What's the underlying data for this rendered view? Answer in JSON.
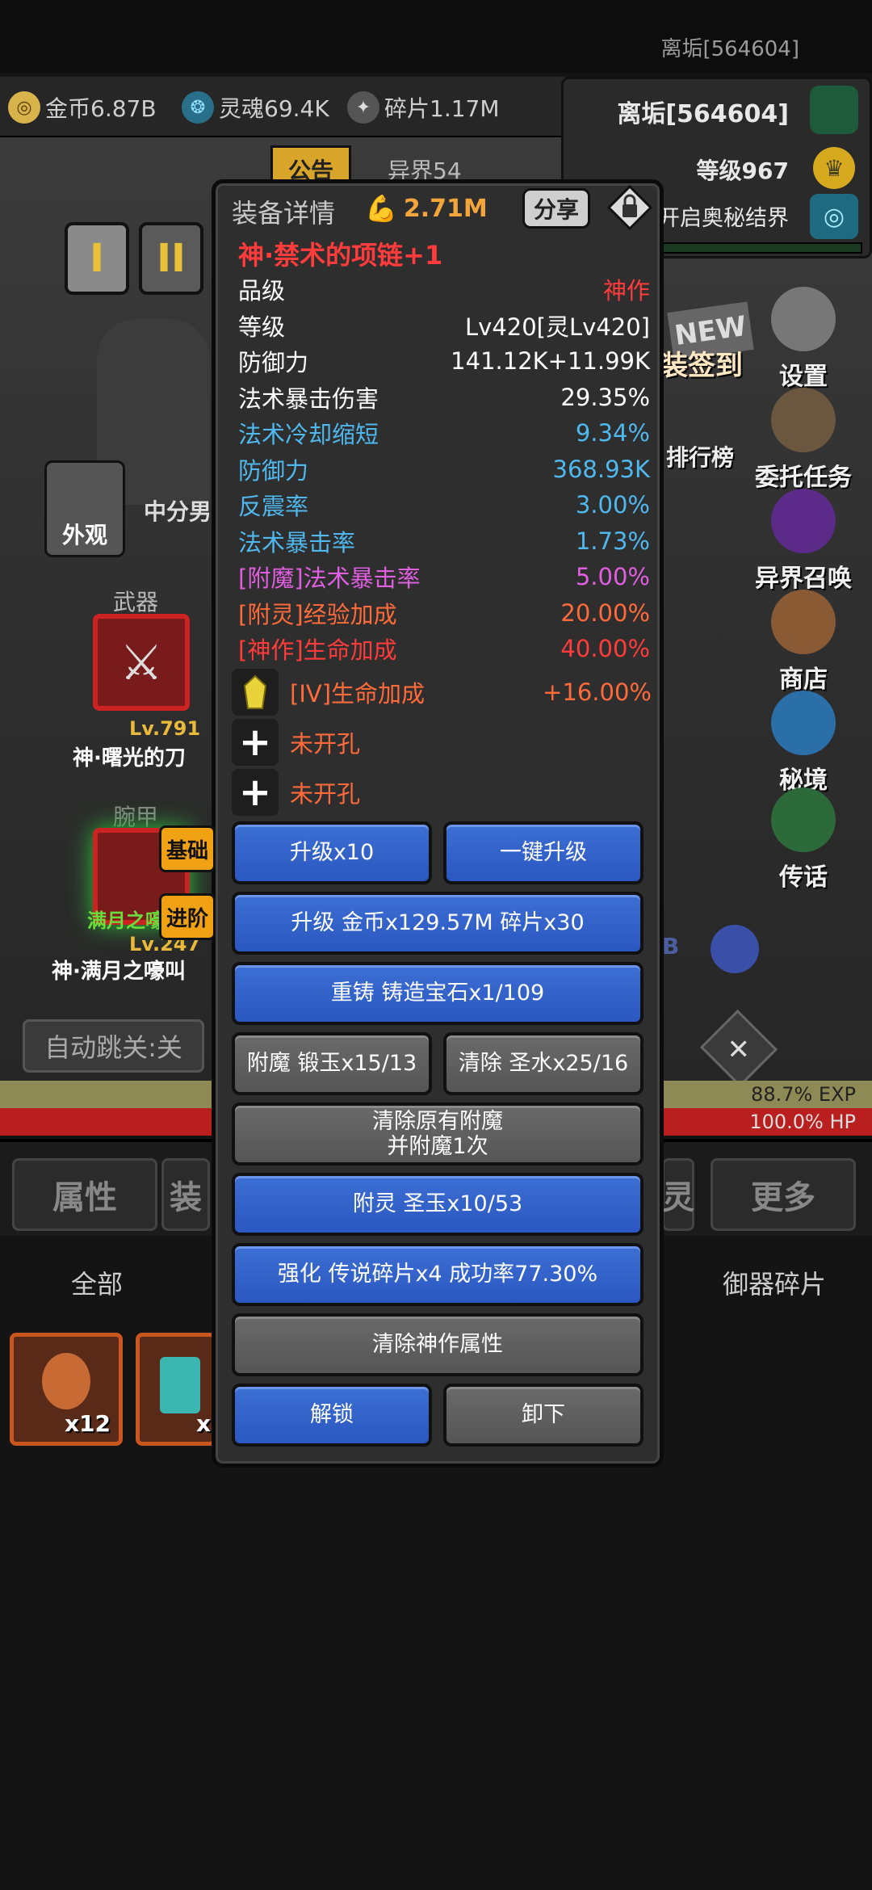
{
  "status": {
    "player": "离垢[564604]"
  },
  "resources": [
    {
      "icon": "gold-coin-icon",
      "label": "金币6.87B",
      "color": "#d8b24a"
    },
    {
      "icon": "soul-icon",
      "label": "灵魂69.4K",
      "color": "#4fb4d9"
    },
    {
      "icon": "shard-icon",
      "label": "碎片1.17M",
      "color": "#b0b0b0"
    }
  ],
  "right_panel": {
    "name": "离垢[564604]",
    "level": "等级967",
    "realm": "开启奥秘结界"
  },
  "scene": {
    "notice": "公告",
    "otherworld": "异界54",
    "tabs_roman": [
      "I",
      "II"
    ],
    "appearance": "外观",
    "char_name": "中分男",
    "weapon_label": "武器",
    "weapon_level": "Lv.791",
    "weapon_name": "神·曙光的刀",
    "wrist_label": "腕甲",
    "wrist_level": "Lv.247",
    "wrist_name": "神·满月之嚎叫",
    "wrist_green": "满月之嚎",
    "auto_skip": "自动跳关:关",
    "sign_in": "装签到",
    "new_badge": "NEW",
    "rank": "排行榜",
    "side_buttons": [
      "设置",
      "委托任务",
      "异界召唤",
      "商店",
      "秘境",
      "传话"
    ],
    "b_text": "B",
    "exp": "88.7% EXP",
    "hp": "100.0% HP",
    "bottom_tabs": [
      "属性",
      "装",
      "灵",
      "更多"
    ],
    "sub_tabs_left": "全部",
    "sub_tabs_right": "御器碎片",
    "inv_counts": [
      "x12",
      "x"
    ]
  },
  "dialog": {
    "title": "装备详情",
    "power": "2.71M",
    "share": "分享",
    "item_name": "神·禁术的项链+1",
    "stats": [
      {
        "k": "品级",
        "v": "神作",
        "kc": "#ffffff",
        "vc": "#ff3b3b"
      },
      {
        "k": "等级",
        "v": "Lv420[灵Lv420]",
        "kc": "#ffffff",
        "vc": "#ffffff"
      },
      {
        "k": "防御力",
        "v": "141.12K+11.99K",
        "kc": "#ffffff",
        "vc": "#ffffff"
      },
      {
        "k": "法术暴击伤害",
        "v": "29.35%",
        "kc": "#ffffff",
        "vc": "#ffffff"
      },
      {
        "k": "法术冷却缩短",
        "v": "9.34%",
        "kc": "#4fb8ee",
        "vc": "#4fb8ee"
      },
      {
        "k": "防御力",
        "v": "368.93K",
        "kc": "#4fb8ee",
        "vc": "#4fb8ee"
      },
      {
        "k": "反震率",
        "v": "3.00%",
        "kc": "#4fb8ee",
        "vc": "#4fb8ee"
      },
      {
        "k": "法术暴击率",
        "v": "1.73%",
        "kc": "#4fb8ee",
        "vc": "#4fb8ee"
      },
      {
        "k": "[附魔]法术暴击率",
        "v": "5.00%",
        "kc": "#e05ee0",
        "vc": "#e05ee0"
      },
      {
        "k": "[附灵]经验加成",
        "v": "20.00%",
        "kc": "#ff6a3a",
        "vc": "#ff6a3a"
      },
      {
        "k": "[神作]生命加成",
        "v": "40.00%",
        "kc": "#ff3b3b",
        "vc": "#ff3b3b"
      }
    ],
    "gem": {
      "k": "[IV]生命加成",
      "v": "+16.00%"
    },
    "slots": [
      "未开孔",
      "未开孔"
    ],
    "tags": [
      "基础",
      "进阶"
    ],
    "buttons": {
      "upgrade10": "升级x10",
      "one_click": "一键升级",
      "upgrade": "升级 金币x129.57M 碎片x30",
      "recast": "重铸 铸造宝石x1/109",
      "enchant": "附魔 锻玉x15/13",
      "clear": "清除 圣水x25/16",
      "clear_enchant_1": "清除原有附魔",
      "clear_enchant_2": "并附魔1次",
      "spirit": "附灵 圣玉x10/53",
      "strengthen": "强化 传说碎片x4 成功率77.30%",
      "clear_divine": "清除神作属性",
      "unlock": "解锁",
      "unequip": "卸下"
    }
  }
}
